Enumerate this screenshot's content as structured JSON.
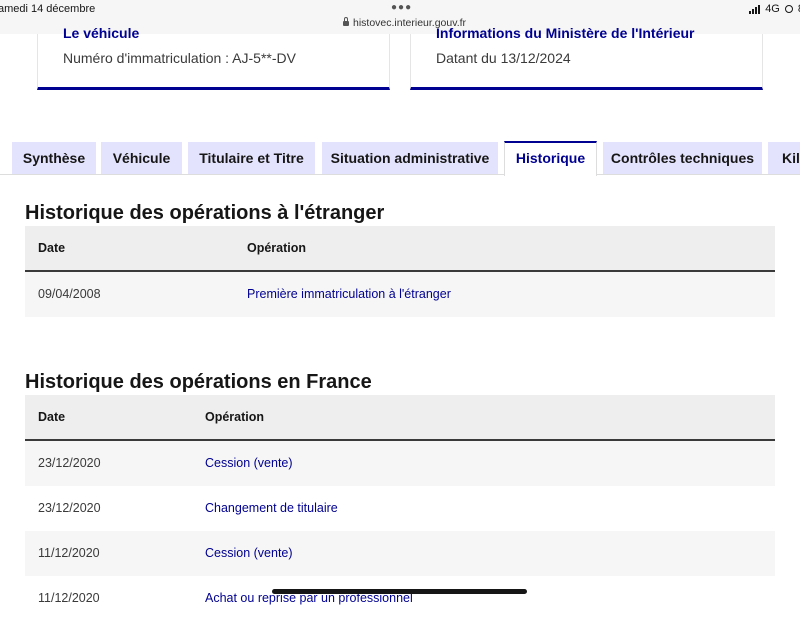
{
  "status_bar": {
    "time": "amedi 14 décembre",
    "url": "histovec.interieur.gouv.fr",
    "network": "4G",
    "battery_partial": "8"
  },
  "cards": [
    {
      "title": "Le véhicule",
      "text": "Numéro d'immatriculation : AJ-5**-DV"
    },
    {
      "title": "Informations du Ministère de l'Intérieur",
      "text": "Datant du 13/12/2024"
    }
  ],
  "tabs": [
    {
      "label": "Synthèse",
      "active": false
    },
    {
      "label": "Véhicule",
      "active": false
    },
    {
      "label": "Titulaire et Titre",
      "active": false
    },
    {
      "label": "Situation administrative",
      "active": false
    },
    {
      "label": "Historique",
      "active": true
    },
    {
      "label": "Contrôles techniques",
      "active": false
    },
    {
      "label": "Kilo",
      "active": false
    }
  ],
  "foreign": {
    "title": "Historique des opérations à l'étranger",
    "columns": [
      "Date",
      "Opération"
    ],
    "rows": [
      {
        "date": "09/04/2008",
        "operation": "Première immatriculation à l'étranger"
      }
    ]
  },
  "france": {
    "title": "Historique des opérations en France",
    "columns": [
      "Date",
      "Opération"
    ],
    "rows": [
      {
        "date": "23/12/2020",
        "operation": "Cession (vente)"
      },
      {
        "date": "23/12/2020",
        "operation": "Changement de titulaire"
      },
      {
        "date": "11/12/2020",
        "operation": "Cession (vente)"
      },
      {
        "date": "11/12/2020",
        "operation": "Achat ou reprise par un professionnel"
      }
    ]
  },
  "colors": {
    "primary": "#000091",
    "tab_bg": "#e3e3fd",
    "header_bg": "#eeeeee",
    "row_alt": "#f6f6f6"
  }
}
